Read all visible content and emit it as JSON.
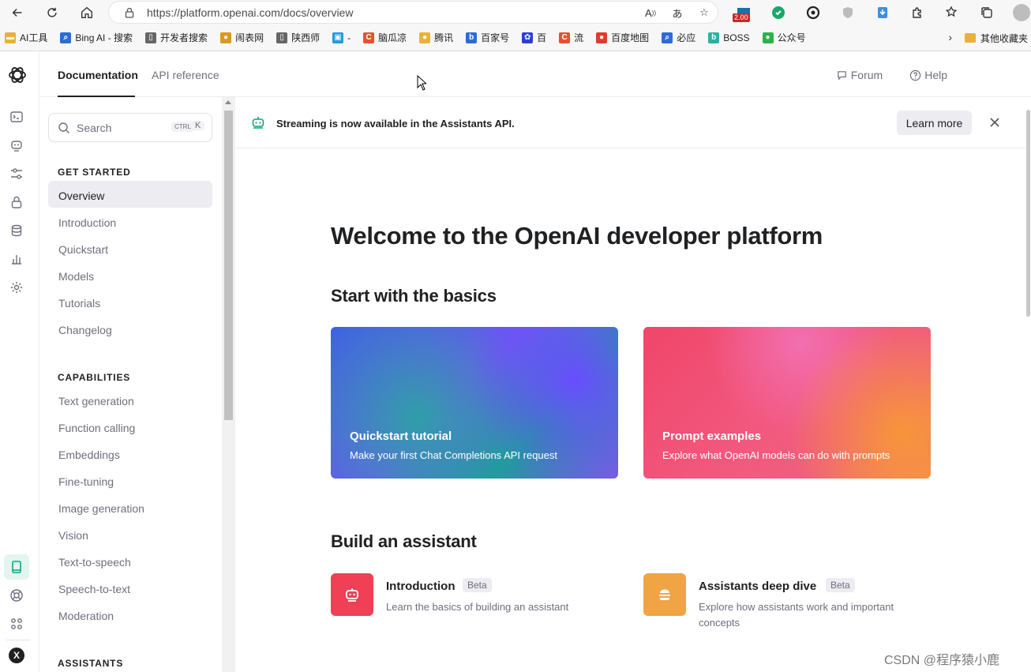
{
  "browser": {
    "url": "https://platform.openai.com/docs/overview",
    "zoom_badge": "2.00",
    "bookmarks": [
      {
        "label": "AI工具",
        "icon": "folder-icon",
        "color": "#e8b13a"
      },
      {
        "label": "Bing AI - 搜索",
        "icon": "search-icon",
        "color": "#2b6cd8"
      },
      {
        "label": "开发者搜索",
        "icon": "page-icon",
        "color": "#666666"
      },
      {
        "label": "闹表网",
        "icon": "trophy-icon",
        "color": "#d99a1e"
      },
      {
        "label": "陕西师",
        "icon": "page-icon",
        "color": "#666666"
      },
      {
        "label": "-",
        "icon": "tv-icon",
        "color": "#1aa0d8"
      },
      {
        "label": "脑瓜凉",
        "icon": "c-icon",
        "color": "#e8512f"
      },
      {
        "label": "腾讯",
        "icon": "bell-icon",
        "color": "#e8b13a"
      },
      {
        "label": "百家号",
        "icon": "b-icon",
        "color": "#2b6cd8"
      },
      {
        "label": "百",
        "icon": "paw-icon",
        "color": "#2b3fd8"
      },
      {
        "label": "流",
        "icon": "c-icon",
        "color": "#e8512f"
      },
      {
        "label": "百度地图",
        "icon": "pin-icon",
        "color": "#e03b2f"
      },
      {
        "label": "必应",
        "icon": "search-icon",
        "color": "#2b6cd8"
      },
      {
        "label": "BOSS",
        "icon": "b-icon",
        "color": "#2bb2a0"
      },
      {
        "label": "公众号",
        "icon": "wechat-icon",
        "color": "#2bb34a"
      }
    ],
    "other_bookmarks": "其他收藏夹"
  },
  "topnav": {
    "tabs": [
      {
        "label": "Documentation",
        "active": true
      },
      {
        "label": "API reference",
        "active": false
      }
    ],
    "forum": "Forum",
    "help": "Help"
  },
  "sidebar": {
    "search_placeholder": "Search",
    "shortcut_ctrl": "CTRL",
    "shortcut_k": "K",
    "sections": [
      {
        "title": "GET STARTED",
        "items": [
          "Overview",
          "Introduction",
          "Quickstart",
          "Models",
          "Tutorials",
          "Changelog"
        ]
      },
      {
        "title": "CAPABILITIES",
        "items": [
          "Text generation",
          "Function calling",
          "Embeddings",
          "Fine-tuning",
          "Image generation",
          "Vision",
          "Text-to-speech",
          "Speech-to-text",
          "Moderation"
        ]
      },
      {
        "title": "ASSISTANTS",
        "items": []
      }
    ],
    "active_item": "Overview"
  },
  "banner": {
    "text": "Streaming is now available in the Assistants API.",
    "button": "Learn more"
  },
  "main": {
    "title": "Welcome to the OpenAI developer platform",
    "basics_heading": "Start with the basics",
    "cards": [
      {
        "title": "Quickstart tutorial",
        "desc": "Make your first Chat Completions API request",
        "accent": "#6e57f0"
      },
      {
        "title": "Prompt examples",
        "desc": "Explore what OpenAI models can do with prompts",
        "accent": "#f0466a"
      }
    ],
    "assistant_heading": "Build an assistant",
    "assistant_items": [
      {
        "title": "Introduction",
        "badge": "Beta",
        "desc_lines": [
          "Learn the basics of building an assistant"
        ],
        "color": "#ef4055",
        "icon": "robot-icon"
      },
      {
        "title": "Assistants deep dive",
        "badge": "Beta",
        "desc_lines": [
          "Explore how assistants work and important",
          "concepts"
        ],
        "color": "#f0a443",
        "icon": "stack-icon"
      }
    ]
  },
  "watermark": "CSDN @程序猿小鹿"
}
